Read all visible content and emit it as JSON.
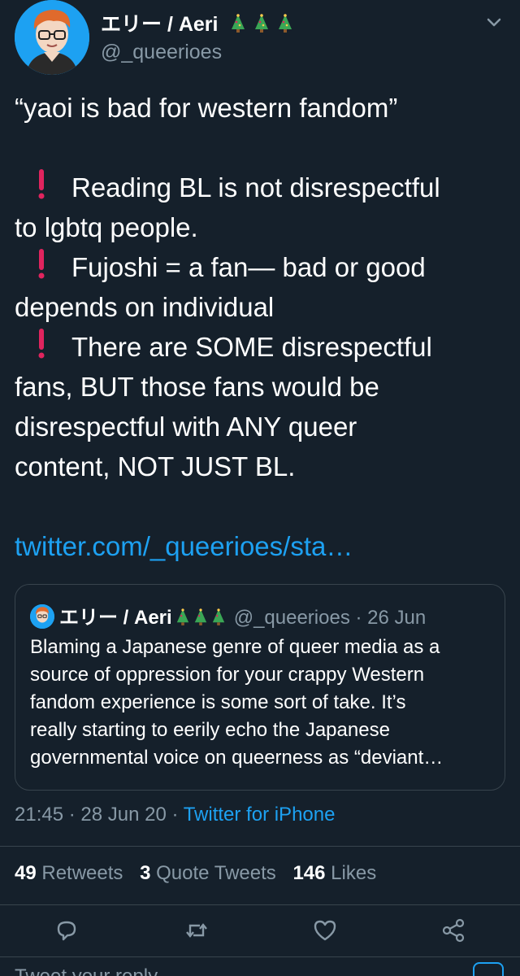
{
  "author": {
    "display_name": "エリー / Aeri",
    "handle": "@_queerioes",
    "name_emoji": "christmas-tree-emoji x3"
  },
  "tweet": {
    "title_line": "“yaoi is bad for western fandom”",
    "points": [
      [
        "Reading BL is not disrespectful",
        "to lgbtq people."
      ],
      [
        "Fujoshi = a fan— bad or good",
        "depends on individual"
      ],
      [
        "There are SOME disrespectful",
        "fans, BUT those fans would be",
        "disrespectful with ANY queer",
        "content, NOT JUST BL."
      ]
    ],
    "link": "twitter.com/_queerioes/sta…"
  },
  "quote": {
    "display_name": "エリー / Aeri",
    "handle_date": "@_queerioes · 26 Jun",
    "text_lines": [
      "Blaming a Japanese genre of queer media as a",
      "source of oppression for your crappy Western",
      "fandom experience is some sort of take. It’s",
      "really starting to eerily echo the Japanese",
      "governmental voice on queerness as “deviant…"
    ]
  },
  "meta": {
    "time_date": "21:45 · 28 Jun 20 · ",
    "source": "Twitter for iPhone"
  },
  "stats": {
    "retweets_count": "49",
    "retweets_label": "Retweets",
    "quotes_count": "3",
    "quotes_label": "Quote Tweets",
    "likes_count": "146",
    "likes_label": "Likes"
  },
  "reply": {
    "placeholder": "Tweet your reply"
  },
  "colors": {
    "background": "#15202b",
    "accent": "#1da1f2",
    "muted": "#8899a6",
    "border": "#38444d",
    "alert": "#e0245e"
  }
}
